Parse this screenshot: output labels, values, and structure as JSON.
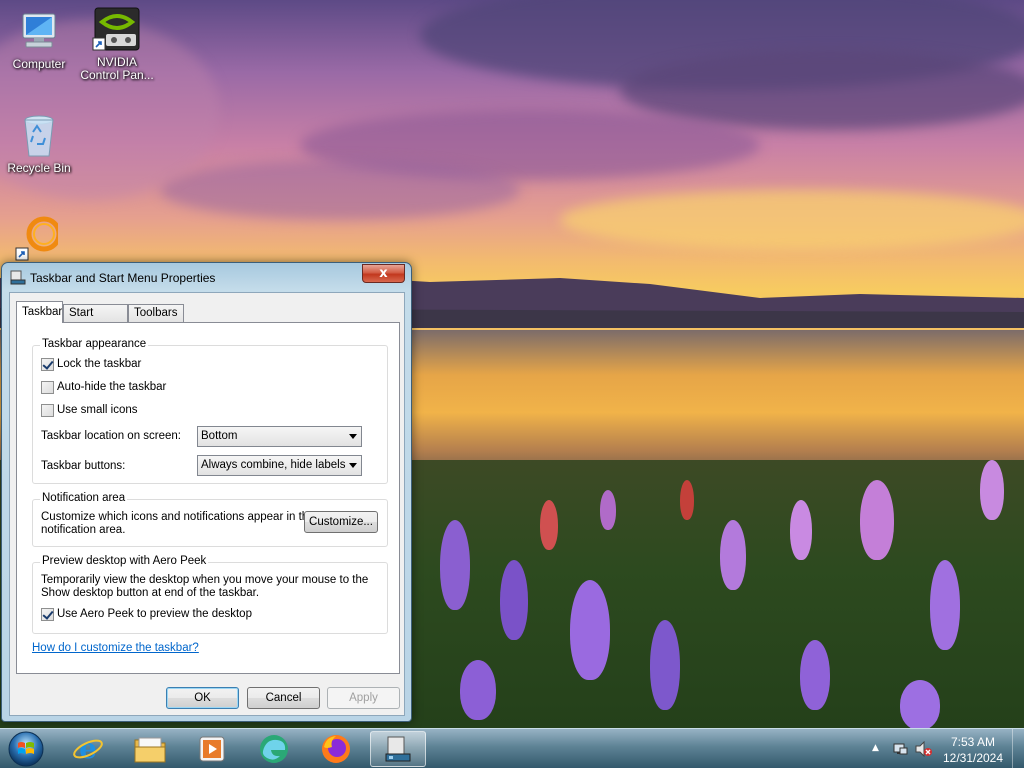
{
  "desktop": {
    "icons": [
      {
        "label": "Computer",
        "icon": "computer-icon"
      },
      {
        "label": "NVIDIA",
        "label2": "Control Pan...",
        "icon": "nvidia-icon"
      },
      {
        "label": "Recycle Bin",
        "icon": "recycle-bin-icon"
      },
      {
        "label": "",
        "icon": "ring-shortcut-icon"
      }
    ]
  },
  "dialog": {
    "title": "Taskbar and Start Menu Properties",
    "close_label": "x",
    "tabs": [
      {
        "label": "Taskbar",
        "active": true
      },
      {
        "label": "Start Menu",
        "active": false
      },
      {
        "label": "Toolbars",
        "active": false
      }
    ],
    "appearance": {
      "title": "Taskbar appearance",
      "lock": {
        "label": "Lock the taskbar",
        "checked": true
      },
      "autohide": {
        "label": "Auto-hide the taskbar",
        "checked": false
      },
      "small_icons": {
        "label": "Use small icons",
        "checked": false
      },
      "location_label": "Taskbar location on screen:",
      "location_value": "Bottom",
      "buttons_label": "Taskbar buttons:",
      "buttons_value": "Always combine, hide labels"
    },
    "notification": {
      "title": "Notification area",
      "text1": "Customize which icons and notifications appear in the",
      "text2": "notification area.",
      "customize_label": "Customize..."
    },
    "peek": {
      "title": "Preview desktop with Aero Peek",
      "text1": "Temporarily view the desktop when you move your mouse to the",
      "text2": "Show desktop button at end of the taskbar.",
      "use_peek": {
        "label": "Use Aero Peek to preview the desktop",
        "checked": true
      }
    },
    "help_link": "How do I customize the taskbar?",
    "ok_label": "OK",
    "cancel_label": "Cancel",
    "apply_label": "Apply"
  },
  "taskbar": {
    "pinned": [
      "internet-explorer-icon",
      "file-explorer-icon",
      "media-player-icon",
      "edge-icon",
      "firefox-icon",
      "taskbar-properties-icon"
    ],
    "clock_time": "7:53 AM",
    "clock_date": "12/31/2024"
  },
  "colors": {
    "link": "#0066cc",
    "close_button": "#c2381e",
    "taskbar": "#3f6f86"
  }
}
